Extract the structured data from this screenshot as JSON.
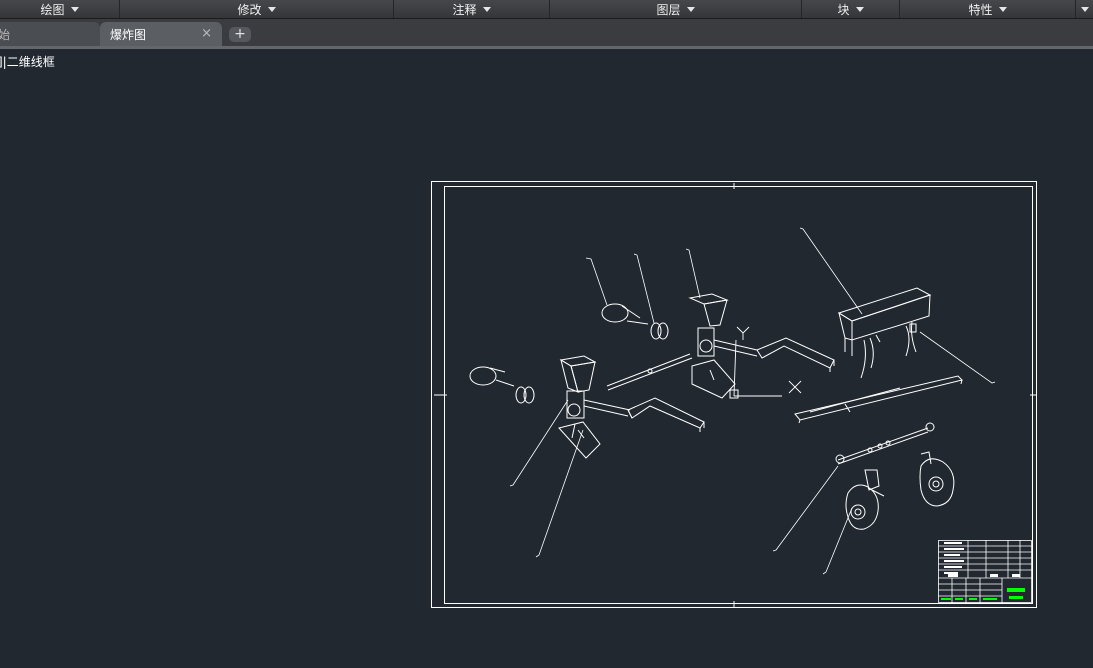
{
  "ribbon": {
    "panels": [
      {
        "label": "绘图"
      },
      {
        "label": "修改"
      },
      {
        "label": "注释"
      },
      {
        "label": "图层"
      },
      {
        "label": "块"
      },
      {
        "label": "特性"
      }
    ]
  },
  "tabs": {
    "start_label": "始",
    "active_label": "爆炸图",
    "close_glyph": "×",
    "new_glyph": "+"
  },
  "viewport": {
    "label": "]|二维线框"
  },
  "ucs": {
    "x_label": "X",
    "y_label": "Y"
  },
  "colors": {
    "background": "#212830",
    "line": "#ffffff",
    "accent_green": "#00ff00"
  }
}
